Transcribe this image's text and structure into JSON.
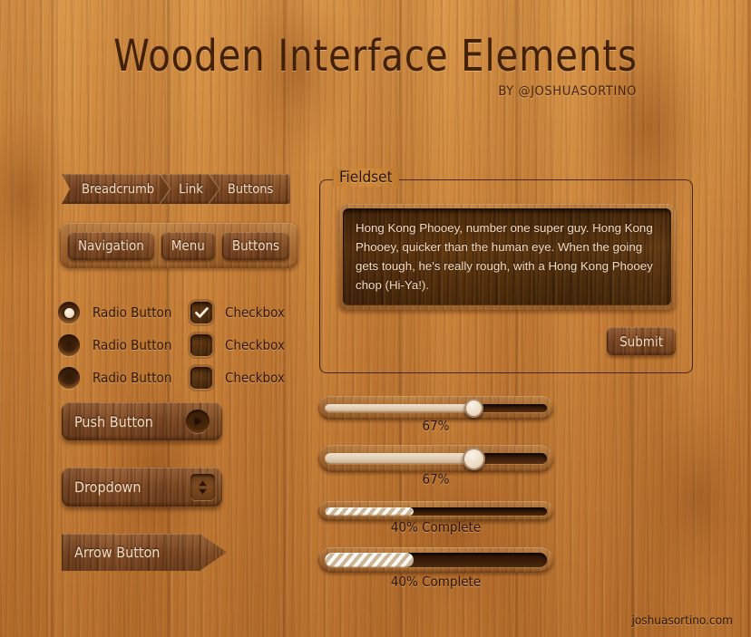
{
  "header": {
    "title": "Wooden Interface Elements",
    "byline": "BY @JOSHUASORTINO"
  },
  "breadcrumb": {
    "items": [
      {
        "label": "Breadcrumb"
      },
      {
        "label": "Link"
      },
      {
        "label": "Buttons"
      }
    ]
  },
  "navbar": {
    "items": [
      {
        "label": "Navigation"
      },
      {
        "label": "Menu"
      },
      {
        "label": "Buttons"
      }
    ]
  },
  "controls": {
    "rows": [
      {
        "radio_label": "Radio Button",
        "radio_checked": true,
        "checkbox_label": "Checkbox",
        "checkbox_checked": true
      },
      {
        "radio_label": "Radio Button",
        "radio_checked": false,
        "checkbox_label": "Checkbox",
        "checkbox_checked": false
      },
      {
        "radio_label": "Radio Button",
        "radio_checked": false,
        "checkbox_label": "Checkbox",
        "checkbox_checked": false
      }
    ]
  },
  "buttons": {
    "push_label": "Push Button",
    "dropdown_label": "Dropdown",
    "arrow_label": "Arrow Button"
  },
  "fieldset": {
    "legend": "Fieldset",
    "textarea_value": "Hong Kong Phooey, number one super guy. Hong Kong Phooey, quicker than the human eye. When the going gets tough, he's really rough, with a Hong Kong Phooey chop (Hi-Ya!).",
    "submit_label": "Submit"
  },
  "sliders": [
    {
      "value_label": "67%",
      "percent": 67
    },
    {
      "value_label": "67%",
      "percent": 67
    }
  ],
  "progress": [
    {
      "value_label": "40%  Complete",
      "percent": 40
    },
    {
      "value_label": "40%  Complete",
      "percent": 40
    }
  ],
  "footer": {
    "text": "joshuasortino.com"
  },
  "colors": {
    "background_wood": "#cd8a3a",
    "dark_wood": "#7c4a22",
    "deep_wood": "#55300f",
    "mid_wood": "#a4662e",
    "text_light": "#f3ddc4",
    "text_dark": "#2b1505"
  }
}
